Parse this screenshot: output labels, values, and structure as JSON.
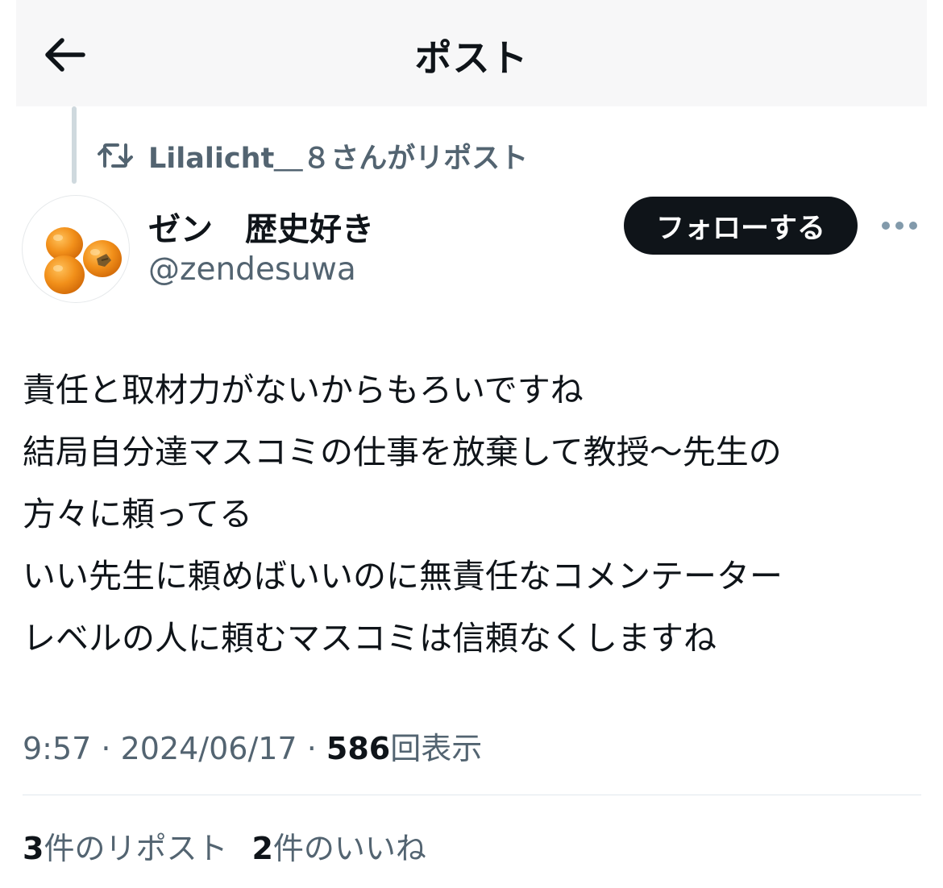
{
  "header": {
    "title": "ポスト",
    "back_icon": "arrow-left-icon"
  },
  "repost": {
    "icon": "repost-icon",
    "text": "Lilalicht＿８さんがリポスト"
  },
  "author": {
    "display_name": "ゼン　歴史好き",
    "handle": "@zendesuwa",
    "avatar": "persimmon-fruit-avatar"
  },
  "follow_button": {
    "label": "フォローする"
  },
  "more_icon": "more-horizontal-icon",
  "post": {
    "lines": [
      "責任と取材力がないからもろいですね",
      "結局自分達マスコミの仕事を放棄して教授〜先生の",
      "方々に頼ってる",
      "いい先生に頼めばいいのに無責任なコメンテーター",
      "レベルの人に頼むマスコミは信頼なくしますね"
    ]
  },
  "meta": {
    "time": "9:57",
    "separator": " · ",
    "date": "2024/06/17",
    "views_count": "586",
    "views_label": "回表示"
  },
  "stats": {
    "reposts_count": "3",
    "reposts_label": "件のリポスト",
    "likes_count": "2",
    "likes_label": "件のいいね"
  },
  "colors": {
    "text_primary": "#0f1419",
    "text_secondary": "#536471",
    "divider": "#e1e8ed",
    "follow_bg": "#0f1419",
    "avatar_orange": "#f08a12"
  }
}
